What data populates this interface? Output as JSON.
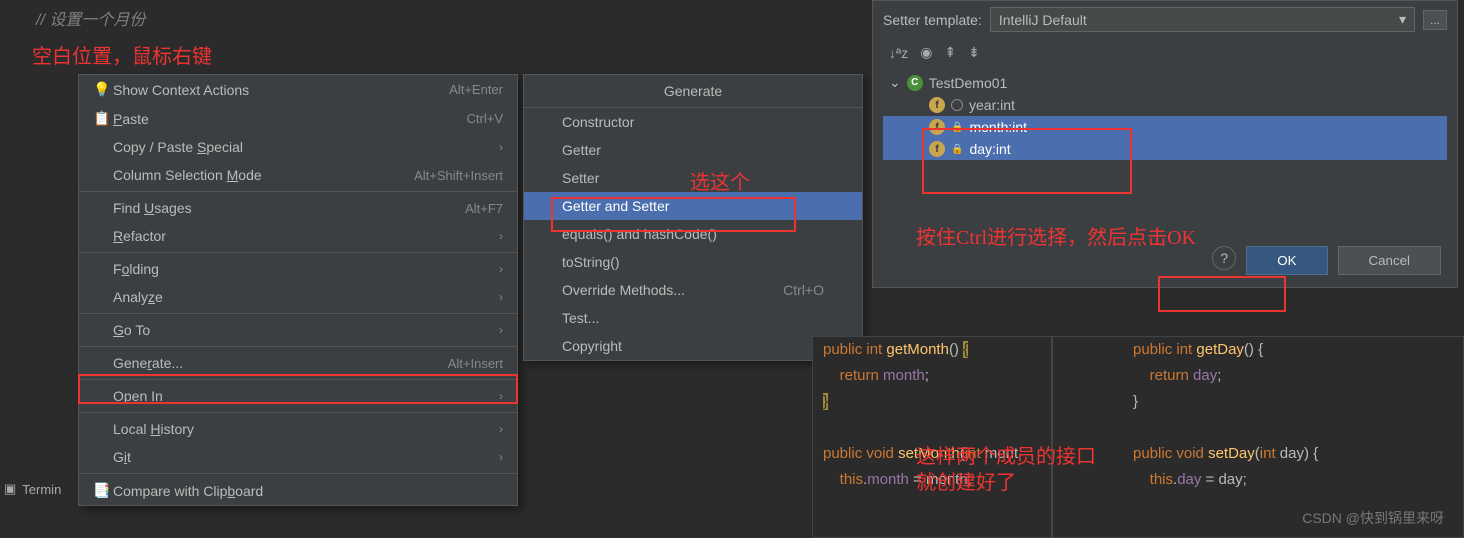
{
  "editor": {
    "comment": "// 设置一个月份"
  },
  "annotations": {
    "a1": "空白位置，鼠标右键",
    "a2": "选这个",
    "a3": "按住Ctrl进行选择，然后点击OK",
    "a4_line1": "这样两个成员的接口",
    "a4_line2": "就创建好了"
  },
  "context_menu": {
    "items": [
      {
        "label_pre": "",
        "u": "",
        "label_post": "Show Context Actions",
        "shortcut": "Alt+Enter",
        "icon": "💡",
        "sub": false
      },
      {
        "label_pre": "",
        "u": "P",
        "label_post": "aste",
        "shortcut": "Ctrl+V",
        "icon": "📋",
        "sub": false
      },
      {
        "label_pre": "Copy / Paste ",
        "u": "S",
        "label_post": "pecial",
        "shortcut": "",
        "icon": "",
        "sub": true
      },
      {
        "label_pre": "Column Selection ",
        "u": "M",
        "label_post": "ode",
        "shortcut": "Alt+Shift+Insert",
        "icon": "",
        "sub": false
      },
      {
        "label_pre": "Find ",
        "u": "U",
        "label_post": "sages",
        "shortcut": "Alt+F7",
        "icon": "",
        "sub": false
      },
      {
        "label_pre": "",
        "u": "R",
        "label_post": "efactor",
        "shortcut": "",
        "icon": "",
        "sub": true
      },
      {
        "label_pre": "F",
        "u": "o",
        "label_post": "lding",
        "shortcut": "",
        "icon": "",
        "sub": true
      },
      {
        "label_pre": "Analy",
        "u": "z",
        "label_post": "e",
        "shortcut": "",
        "icon": "",
        "sub": true
      },
      {
        "label_pre": "",
        "u": "G",
        "label_post": "o To",
        "shortcut": "",
        "icon": "",
        "sub": true
      },
      {
        "label_pre": "Gene",
        "u": "r",
        "label_post": "ate...",
        "shortcut": "Alt+Insert",
        "icon": "",
        "sub": false
      },
      {
        "label_pre": "Ope",
        "u": "n",
        "label_post": " In",
        "shortcut": "",
        "icon": "",
        "sub": true
      },
      {
        "label_pre": "Local ",
        "u": "H",
        "label_post": "istory",
        "shortcut": "",
        "icon": "",
        "sub": true
      },
      {
        "label_pre": "G",
        "u": "i",
        "label_post": "t",
        "shortcut": "",
        "icon": "",
        "sub": true
      },
      {
        "label_pre": "Compare with Clip",
        "u": "b",
        "label_post": "oard",
        "shortcut": "",
        "icon": "📑",
        "sub": false
      }
    ]
  },
  "submenu": {
    "title": "Generate",
    "items": [
      {
        "label": "Constructor",
        "shortcut": ""
      },
      {
        "label": "Getter",
        "shortcut": ""
      },
      {
        "label": "Setter",
        "shortcut": ""
      },
      {
        "label": "Getter and Setter",
        "shortcut": ""
      },
      {
        "label": "equals() and hashCode()",
        "shortcut": ""
      },
      {
        "label": "toString()",
        "shortcut": ""
      },
      {
        "label": "Override Methods...",
        "shortcut": "Ctrl+O"
      },
      {
        "label": "Test...",
        "shortcut": ""
      },
      {
        "label": "Copyright",
        "shortcut": ""
      }
    ],
    "selected_index": 3
  },
  "dialog": {
    "template_label": "Setter template:",
    "template_value": "IntelliJ Default",
    "tree": {
      "class": "TestDemo01",
      "fields": [
        {
          "name": "year:int",
          "selected": false,
          "locked": false
        },
        {
          "name": "month:int",
          "selected": true,
          "locked": true
        },
        {
          "name": "day:int",
          "selected": true,
          "locked": true
        }
      ]
    },
    "ok": "OK",
    "cancel": "Cancel"
  },
  "code_left": {
    "l1": "public int getMonth() {",
    "l2": "    return month;",
    "l3": "}",
    "l4": "",
    "l5": "public void setMonth(int mont",
    "l6": "    this.month = month;"
  },
  "code_right": {
    "l1": "public int getDay() {",
    "l2": "    return day;",
    "l3": "}",
    "l4": "",
    "l5": "public void setDay(int day) {",
    "l6": "    this.day = day;"
  },
  "terminal": "Termin",
  "watermark": "CSDN @快到锅里来呀"
}
